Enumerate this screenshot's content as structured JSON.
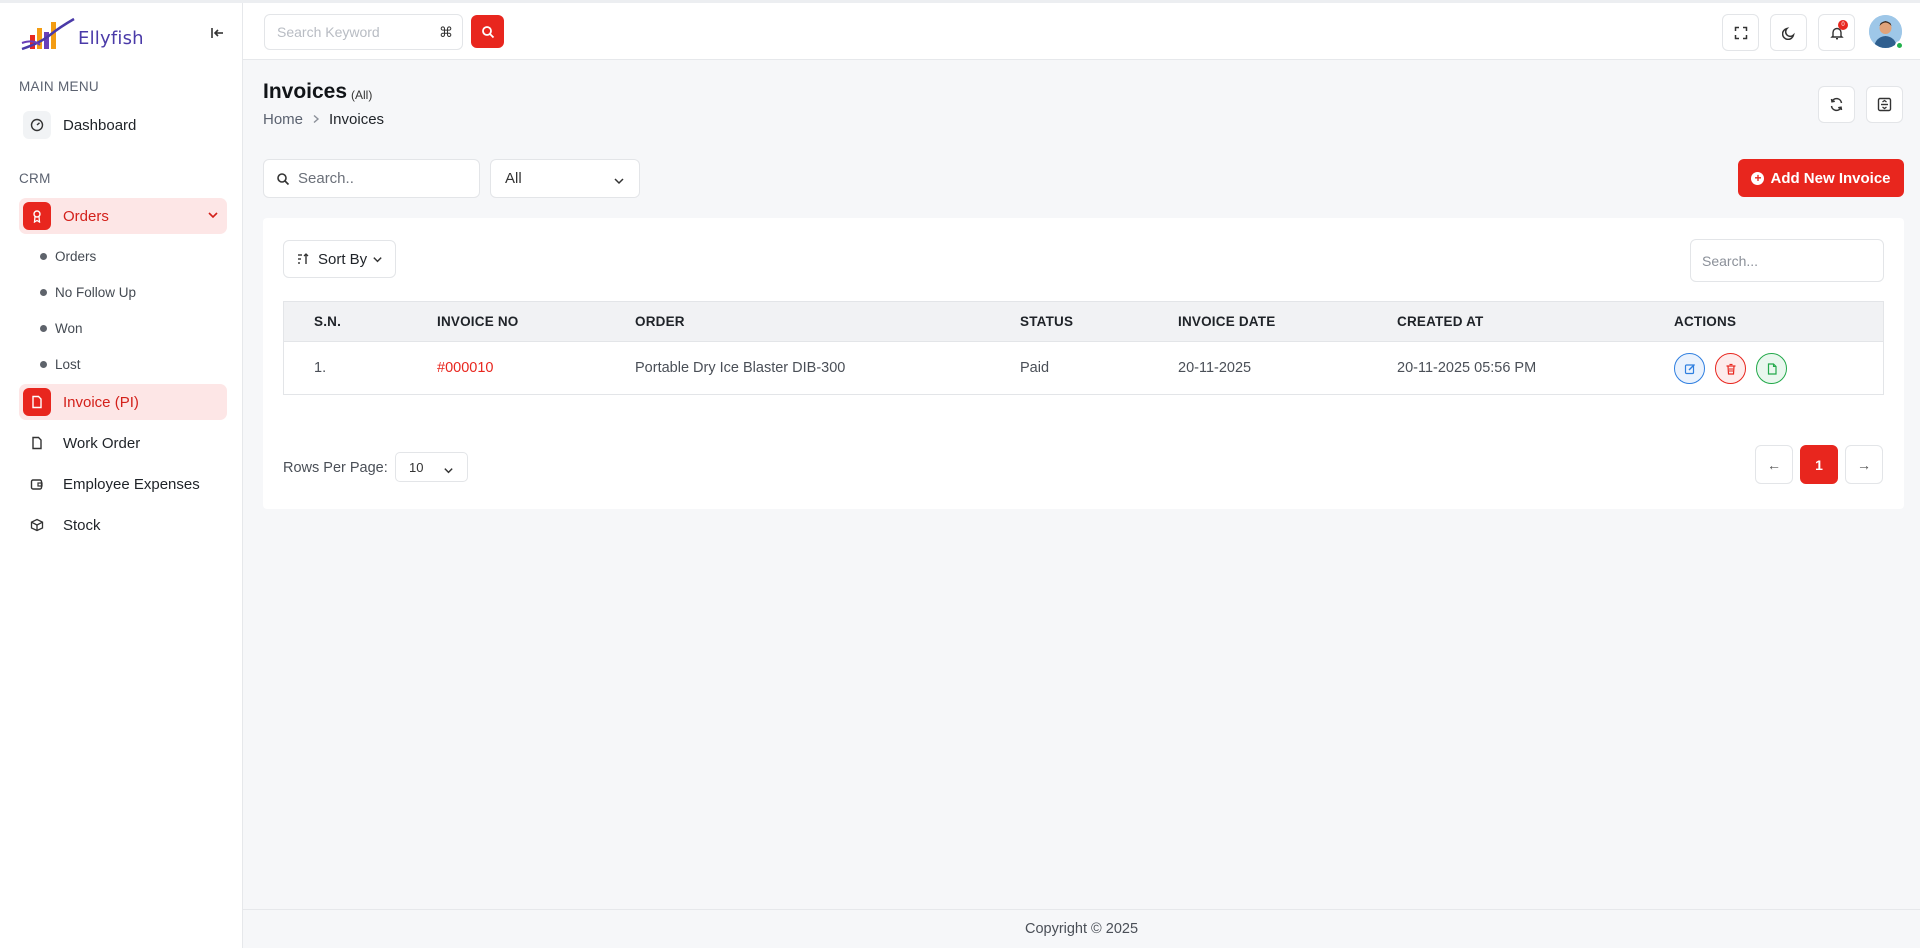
{
  "app": {
    "logo_text": "Ellyfish"
  },
  "header": {
    "search_placeholder": "Search Keyword",
    "shortcut_symbol": "⌘",
    "notification_count": "0"
  },
  "sidebar": {
    "main_menu_label": "MAIN MENU",
    "crm_label": "CRM",
    "dashboard": "Dashboard",
    "orders": "Orders",
    "orders_sub": [
      "Orders",
      "No Follow Up",
      "Won",
      "Lost"
    ],
    "invoice": "Invoice (PI)",
    "work_order": "Work Order",
    "employee_expenses": "Employee Expenses",
    "stock": "Stock"
  },
  "page": {
    "title": "Invoices",
    "title_filter": "(All)",
    "breadcrumb_home": "Home",
    "breadcrumb_current": "Invoices"
  },
  "filters": {
    "search_placeholder": "Search..",
    "status_value": "All",
    "add_button": "Add New Invoice"
  },
  "table": {
    "sort_label": "Sort By",
    "search_placeholder": "Search...",
    "columns": [
      "S.N.",
      "INVOICE NO",
      "ORDER",
      "STATUS",
      "INVOICE DATE",
      "CREATED AT",
      "ACTIONS"
    ],
    "rows": [
      {
        "sn": "1.",
        "invoice_no": "#000010",
        "order": "Portable Dry Ice Blaster DIB-300",
        "status": "Paid",
        "invoice_date": "20-11-2025",
        "created_at": "20-11-2025 05:56 PM"
      }
    ]
  },
  "pagination": {
    "rows_per_page_label": "Rows Per Page:",
    "rows_per_page_value": "10",
    "current_page": "1",
    "prev_symbol": "←",
    "next_symbol": "→"
  },
  "footer": {
    "copyright": "Copyright © 2025"
  },
  "colors": {
    "accent": "#e8261e",
    "active_bg": "#fde6e6",
    "edit": "#2f7fe0",
    "success": "#22a94a"
  },
  "icons": {
    "collapse": "collapse-left-icon",
    "dashboard": "gauge-icon",
    "orders": "award-icon",
    "invoice": "file-icon",
    "work_order": "file-icon",
    "employee_expenses": "wallet-icon",
    "stock": "box-icon",
    "fullscreen": "fullscreen-icon",
    "theme": "moon-icon",
    "notifications": "bell-icon",
    "refresh": "refresh-icon",
    "collapse_header": "collapse-icon",
    "actions": [
      "edit-icon",
      "trash-icon",
      "document-icon"
    ]
  }
}
